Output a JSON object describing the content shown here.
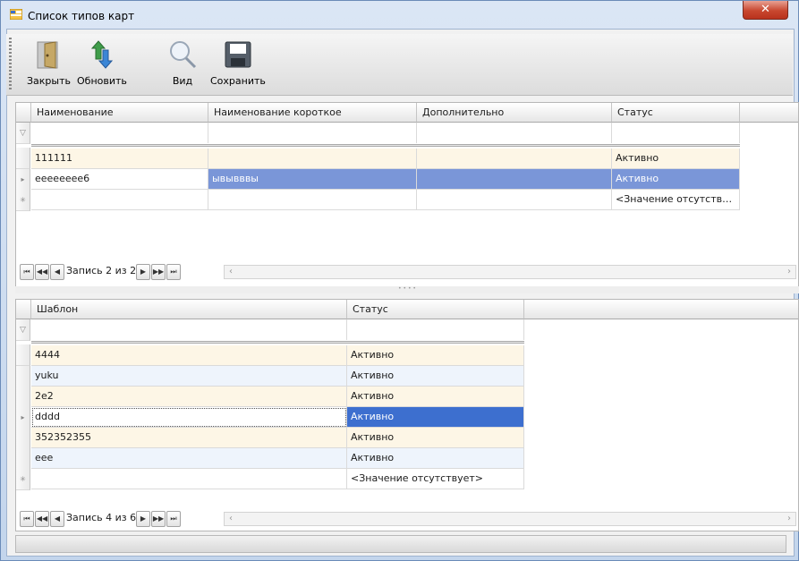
{
  "window": {
    "title": "Список типов карт"
  },
  "toolbar": {
    "items": [
      {
        "label": "Закрыть",
        "icon": "door-exit-icon"
      },
      {
        "label": "Обновить",
        "icon": "refresh-arrows-icon"
      },
      {
        "label": "Вид",
        "icon": "magnifier-icon"
      },
      {
        "label": "Сохранить",
        "icon": "floppy-disk-icon"
      }
    ]
  },
  "top_grid": {
    "columns": [
      "Наименование",
      "Наименование короткое",
      "Дополнительно",
      "Статус"
    ],
    "rows": [
      {
        "name": "111111",
        "short": "",
        "extra": "",
        "status": "Активно"
      },
      {
        "name": "eeeeeeee6",
        "short": "ывывввы",
        "extra": "",
        "status": "Активно"
      },
      {
        "name": "",
        "short": "",
        "extra": "",
        "status": "<Значение отсутств…"
      }
    ],
    "selected_row": 2,
    "navigator": {
      "record_text": "Запись 2 из 2"
    }
  },
  "bottom_grid": {
    "columns": [
      "Шаблон",
      "Статус"
    ],
    "rows": [
      {
        "template": "4444",
        "status": "Активно"
      },
      {
        "template": "yuku",
        "status": "Активно"
      },
      {
        "template": "2e2",
        "status": "Активно"
      },
      {
        "template": "dddd",
        "status": "Активно"
      },
      {
        "template": "352352355",
        "status": "Активно"
      },
      {
        "template": "eee",
        "status": "Активно"
      },
      {
        "template": "",
        "status": "<Значение отсутствует>"
      }
    ],
    "selected_row": 4,
    "navigator": {
      "record_text": "Запись 4 из 6"
    }
  },
  "colors": {
    "title_bar": "#dbe6f5",
    "close_button": "#c8472f",
    "row_odd": "#fdf6e6",
    "row_even": "#eef4fc",
    "selection_soft": "#7a96d8",
    "selection_strong": "#3d6fcf"
  }
}
